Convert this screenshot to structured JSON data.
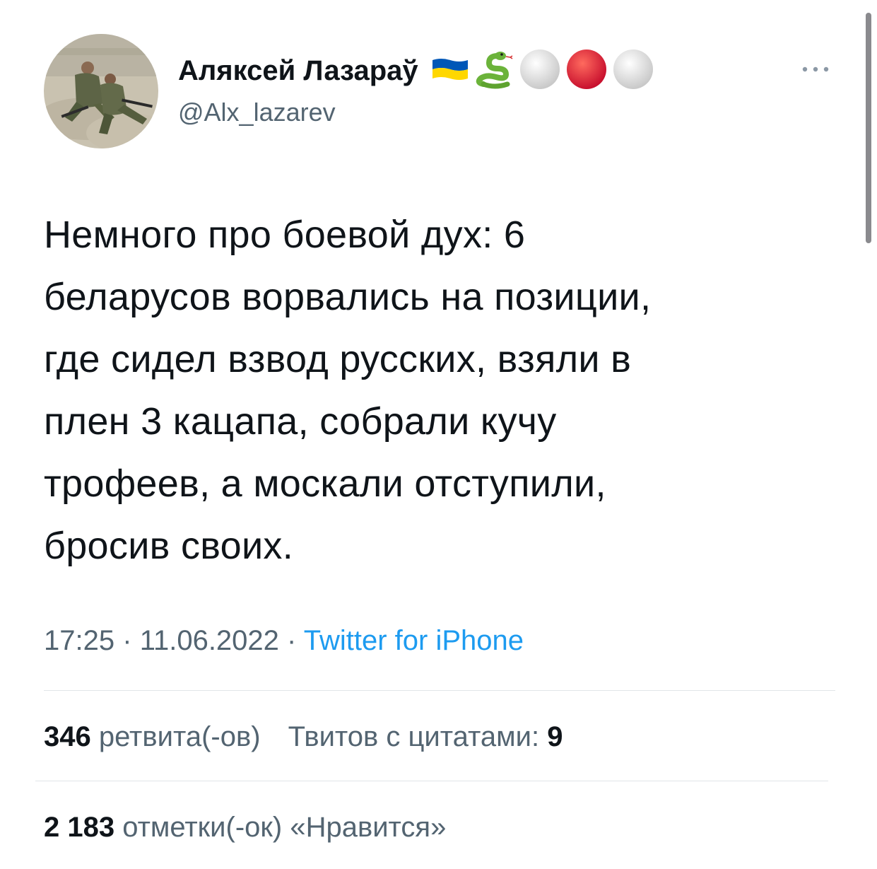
{
  "author": {
    "display_name": "Аляксей Лазараў",
    "handle": "@Alx_lazarev",
    "name_emojis": [
      "ukraine-flag-emoji",
      "snake-emoji",
      "white-circle-emoji",
      "red-circle-emoji",
      "white-circle-emoji"
    ]
  },
  "more_button": {
    "icon": "ellipsis-icon"
  },
  "tweet": {
    "text": "Немного про боевой дух: 6\nбеларусов ворвались на позиции,\nгде сидел взвод русских, взяли в\nплен 3 кацапа, собрали кучу\nтрофеев, а москали отступили,\nбросив своих.",
    "time": "17:25",
    "separator": "·",
    "date": "11.06.2022",
    "source": "Twitter for iPhone"
  },
  "stats": {
    "retweets_count": "346",
    "retweets_label": "ретвита(-ов)",
    "quotes_label": "Твитов с цитатами:",
    "quotes_count": "9",
    "likes_count": "2 183",
    "likes_label": "отметки(-ок) «Нравится»"
  },
  "colors": {
    "text": "#0f1419",
    "secondary": "#536471",
    "link": "#1d9bf0",
    "divider": "#e1e5e8"
  }
}
